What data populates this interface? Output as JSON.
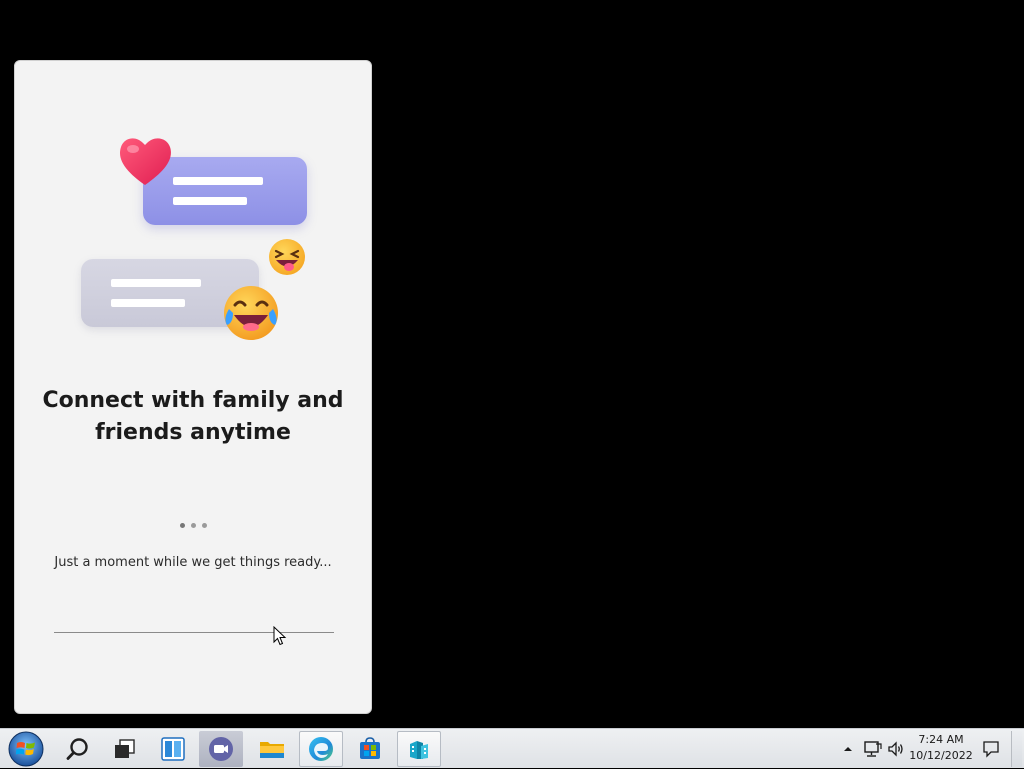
{
  "splash": {
    "title_line1": "Connect with family and",
    "title_line2": "friends anytime",
    "loading_text": "Just a moment while we get things ready..."
  },
  "illustration": {
    "icons": [
      "heart-icon",
      "chat-bubble-purple",
      "chat-bubble-gray",
      "squinting-tongue-emoji",
      "tears-of-joy-emoji"
    ]
  },
  "taskbar": {
    "items": [
      {
        "name": "start-button",
        "icon": "windows-logo-icon"
      },
      {
        "name": "search",
        "icon": "search-icon"
      },
      {
        "name": "task-view",
        "icon": "task-view-icon"
      },
      {
        "name": "widgets",
        "icon": "widgets-icon"
      },
      {
        "name": "meet-now",
        "icon": "video-camera-icon"
      },
      {
        "name": "file-explorer",
        "icon": "folder-icon"
      },
      {
        "name": "edge",
        "icon": "edge-icon"
      },
      {
        "name": "microsoft-store",
        "icon": "store-icon"
      },
      {
        "name": "app",
        "icon": "building-blocks-icon"
      }
    ],
    "tray": {
      "time": "7:24 AM",
      "date": "10/12/2022"
    }
  },
  "colors": {
    "desktop": "#000000",
    "splash_bg": "#f3f3f3",
    "bubble_purple": "#9a9ceb",
    "bubble_gray": "#d0d0dd",
    "taskbar": "#e6e9ec"
  }
}
